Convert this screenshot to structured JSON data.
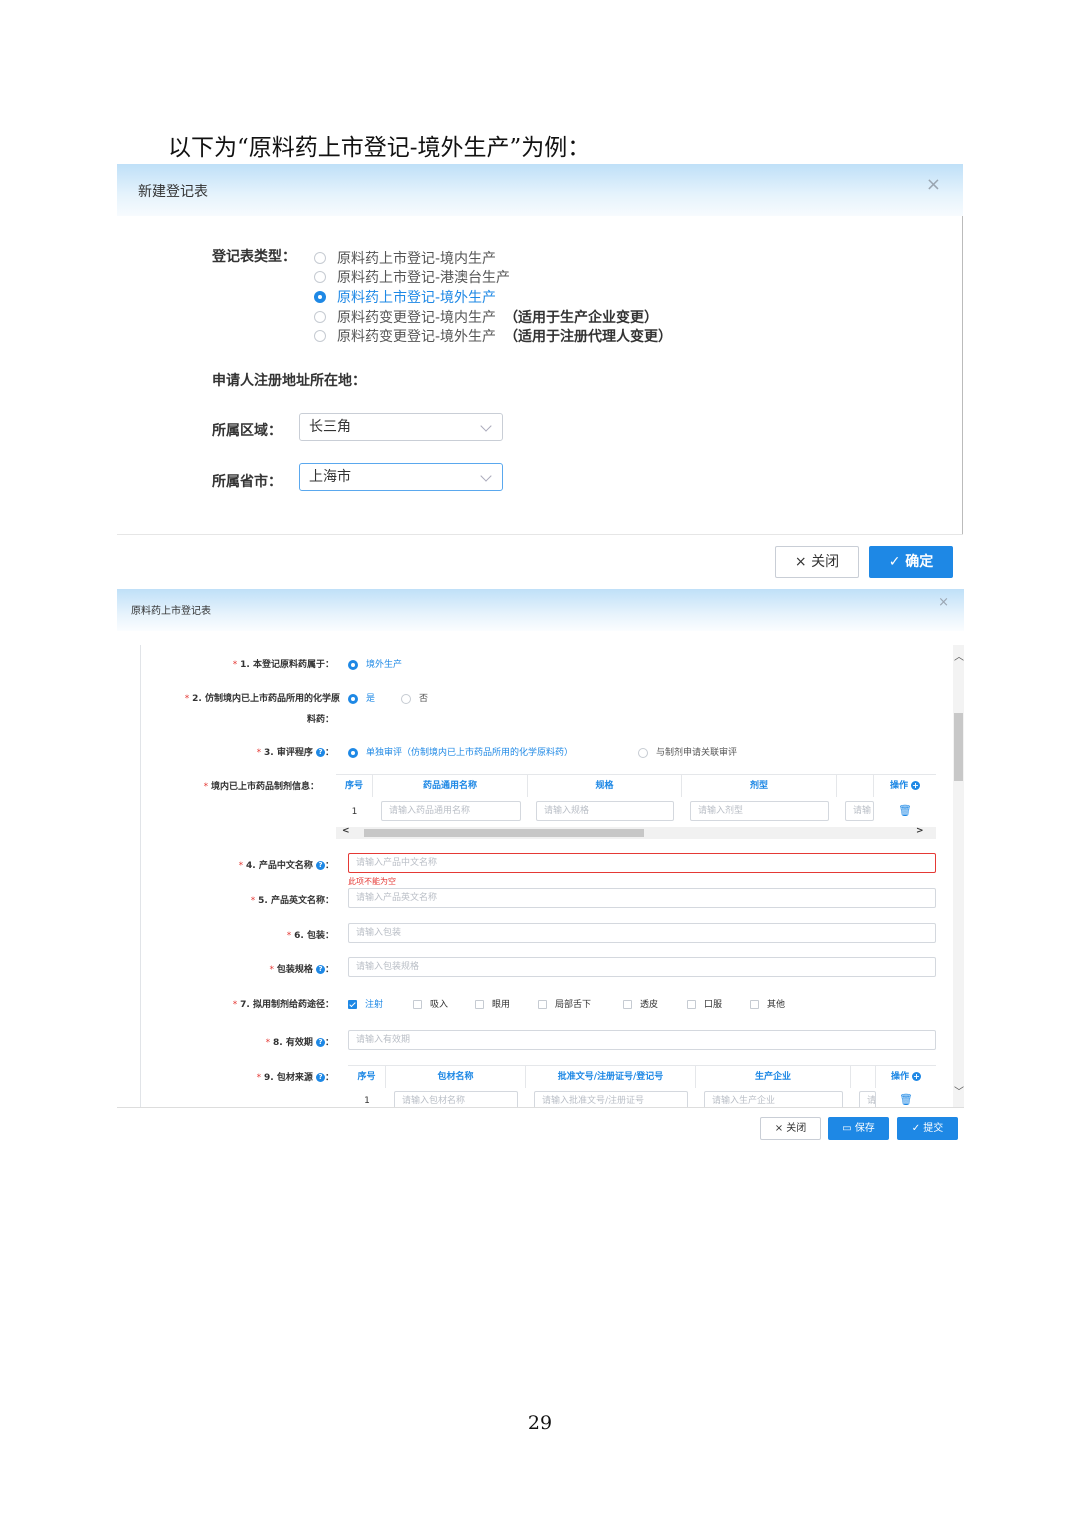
{
  "intro_text": "以下为“原料药上市登记-境外生产”为例：",
  "page_number": "29",
  "dialog1": {
    "title": "新建登记表",
    "close_icon": "×",
    "type_label": "登记表类型：",
    "options": [
      {
        "label": "原料药上市登记-境内生产",
        "note": "",
        "selected": false
      },
      {
        "label": "原料药上市登记-港澳台生产",
        "note": "",
        "selected": false
      },
      {
        "label": "原料药上市登记-境外生产",
        "note": "",
        "selected": true
      },
      {
        "label": "原料药变更登记-境内生产",
        "note": "（适用于生产企业变更）",
        "selected": false
      },
      {
        "label": "原料药变更登记-境外生产",
        "note": "（适用于注册代理人变更）",
        "selected": false
      }
    ],
    "address_label": "申请人注册地址所在地：",
    "region_label": "所属区域：",
    "region_value": "长三角",
    "province_label": "所属省市：",
    "province_value": "上海市",
    "close_btn": "× 关闭",
    "confirm_btn": "✓ 确定"
  },
  "dialog2": {
    "title": "原料药上市登记表",
    "close_icon": "×",
    "f1_label": "1. 本登记原料药属于：",
    "f1_value": "境外生产",
    "f2_label_a": "2. 仿制境内已上市药品所用的化学原",
    "f2_label_b": "料药：",
    "f2_yes": "是",
    "f2_no": "否",
    "f3_label": "3. 审评程序",
    "f3_opt1": "单独审评（仿制境内已上市药品所用的化学原料药）",
    "f3_opt2": "与制剂申请关联审评",
    "prep_label": "境内已上市药品制剂信息：",
    "prep_table": {
      "headers": [
        "序号",
        "药品通用名称",
        "规格",
        "剂型",
        "操作"
      ],
      "row_index": "1",
      "placeholders": [
        "请输入药品通用名称",
        "请输入规格",
        "请输入剂型",
        "请输"
      ]
    },
    "f4_label": "4. 产品中文名称",
    "f4_placeholder": "请输入产品中文名称",
    "f4_error": "此项不能为空",
    "f5_label": "5. 产品英文名称：",
    "f5_placeholder": "请输入产品英文名称",
    "f6_label": "6. 包装：",
    "f6_placeholder": "请输入包装",
    "pack_spec_label": "包装规格",
    "pack_spec_placeholder": "请输入包装规格",
    "f7_label": "7. 拟用制剂给药途径：",
    "routes": [
      {
        "label": "注射",
        "checked": true
      },
      {
        "label": "吸入",
        "checked": false
      },
      {
        "label": "眼用",
        "checked": false
      },
      {
        "label": "局部舌下",
        "checked": false
      },
      {
        "label": "透皮",
        "checked": false
      },
      {
        "label": "口服",
        "checked": false
      },
      {
        "label": "其他",
        "checked": false
      }
    ],
    "f8_label": "8. 有效期",
    "f8_placeholder": "请输入有效期",
    "f9_label": "9. 包材来源",
    "pkg_table": {
      "headers": [
        "序号",
        "包材名称",
        "批准文号/注册证号/登记号",
        "生产企业",
        "操作"
      ],
      "row_index": "1",
      "placeholders": [
        "请输入包材名称",
        "请输入批准文号/注册证号",
        "请输入生产企业",
        "请"
      ]
    },
    "colon": "：",
    "btn_close": "× 关闭",
    "btn_save": "保存",
    "btn_submit": "✓ 提交"
  },
  "colors": {
    "primary": "#1e88e5",
    "error": "#e53935",
    "header_gradient": "#bfe0f8"
  }
}
